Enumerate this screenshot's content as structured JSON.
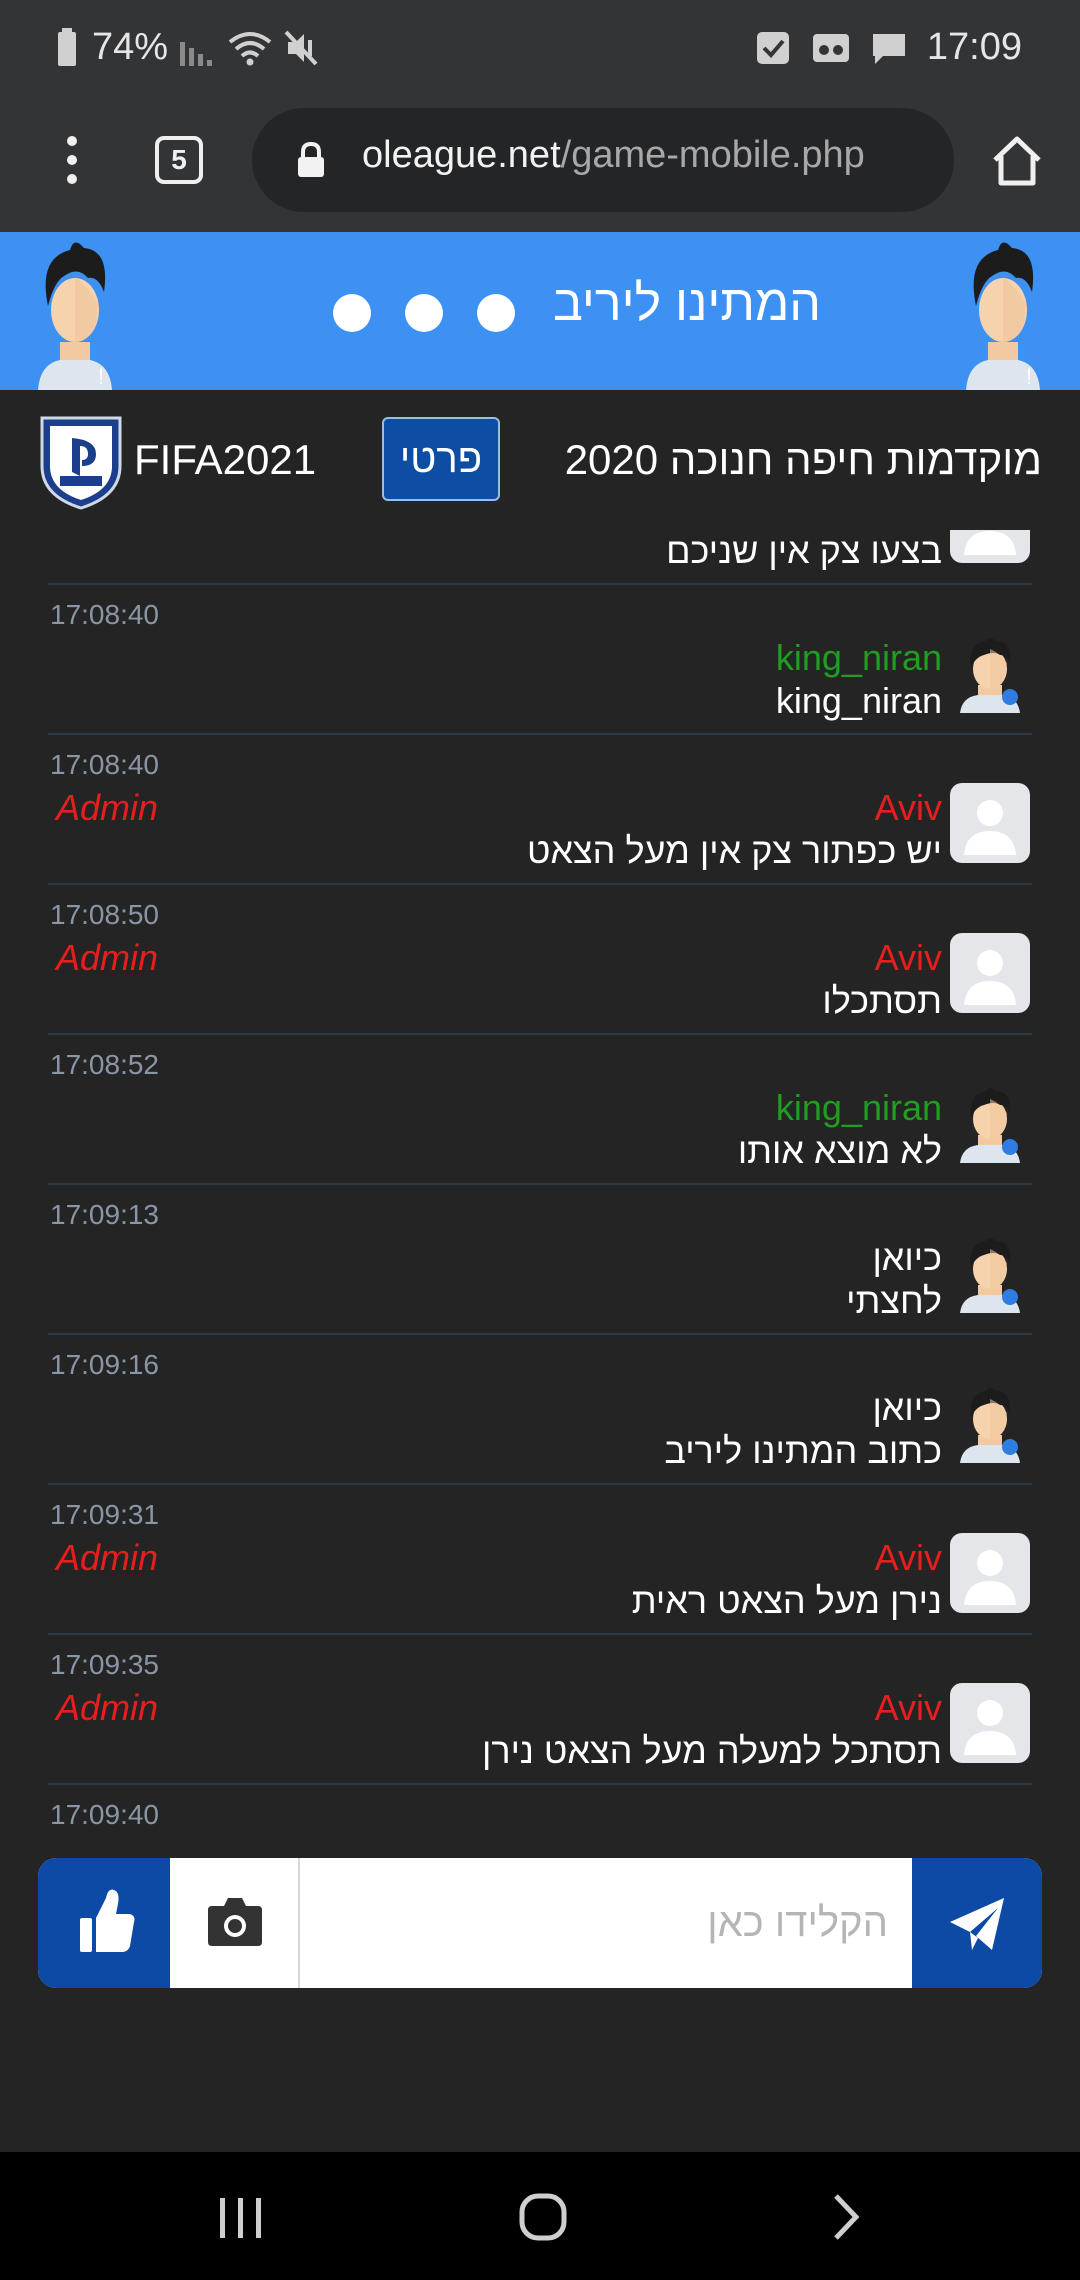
{
  "status_bar": {
    "battery": "74%",
    "time": "17:09"
  },
  "browser": {
    "tab_count": "5",
    "url_domain": "oleague.net",
    "url_path": "/game-mobile.php"
  },
  "banner": {
    "title": "המתינו ליריב"
  },
  "info": {
    "game_name": "FIFA2021",
    "teams_button": "פרטי",
    "tournament": "מוקדמות חיפה חנוכה 2020"
  },
  "chat": {
    "partial_message": "בצעו צק אין שניכם",
    "messages": [
      {
        "time": "17:08:40",
        "name": "king_niran",
        "text": "king_niran",
        "role": ""
      },
      {
        "time": "17:08:40",
        "name": "Aviv",
        "text": "יש כפתור צק אין מעל הצאט",
        "role": "Admin"
      },
      {
        "time": "17:08:50",
        "name": "Aviv",
        "text": "תסתכלו",
        "role": "Admin"
      },
      {
        "time": "17:08:52",
        "name": "king_niran",
        "text": "לא מוצא אותו",
        "role": ""
      },
      {
        "time": "17:09:13",
        "name": "כיואן",
        "text": "לחצתי",
        "role": ""
      },
      {
        "time": "17:09:16",
        "name": "כיואן",
        "text": "כתוב המתינו ליריב",
        "role": ""
      },
      {
        "time": "17:09:31",
        "name": "Aviv",
        "text": "נירן מעל הצאט ראית",
        "role": "Admin"
      },
      {
        "time": "17:09:35",
        "name": "Aviv",
        "text": "תסתכל למעלה מעל הצאט נירן",
        "role": "Admin"
      }
    ],
    "last_time": "17:09:40"
  },
  "composer": {
    "placeholder": "הקלידו כאן"
  },
  "colors": {
    "banner": "#3d91f3",
    "accent_blue": "#0c4aa6",
    "admin_red": "#e81e1e",
    "user_green": "#1f9e1f"
  },
  "icons": {
    "like": "thumbs-up-icon",
    "camera": "camera-icon",
    "send": "paper-plane-icon"
  }
}
